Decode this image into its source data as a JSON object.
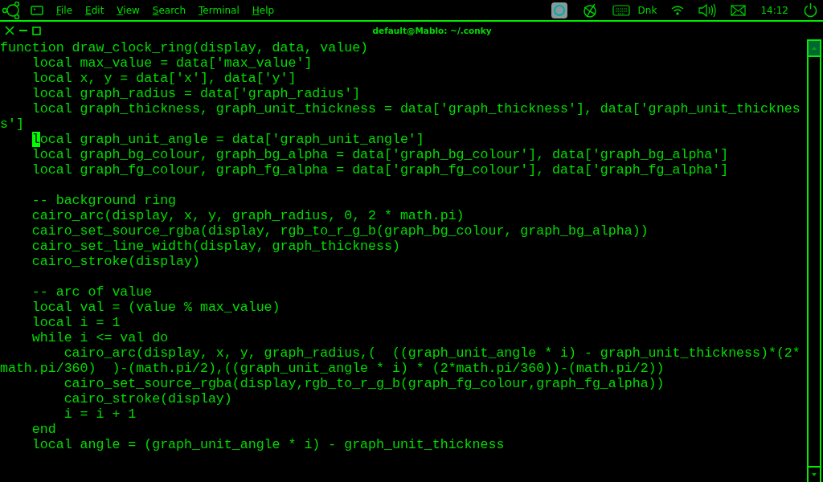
{
  "top_panel": {
    "menus": [
      {
        "label": "File"
      },
      {
        "label": "Edit"
      },
      {
        "label": "View"
      },
      {
        "label": "Search"
      },
      {
        "label": "Terminal"
      },
      {
        "label": "Help"
      }
    ],
    "keyboard_layout": "Dnk",
    "clock": "14:12"
  },
  "terminal": {
    "title": "default@Mablo: ~/.conky",
    "lines": [
      {
        "kind": "code",
        "text": "function draw_clock_ring(display, data, value)"
      },
      {
        "kind": "code",
        "text": "    local max_value = data['max_value']"
      },
      {
        "kind": "code",
        "text": "    local x, y = data['x'], data['y']"
      },
      {
        "kind": "code",
        "text": "    local graph_radius = data['graph_radius']"
      },
      {
        "kind": "code",
        "text": "    local graph_thickness, graph_unit_thickness = data['graph_thickness'], data['graph_unit_thicknes"
      },
      {
        "kind": "code",
        "text": "s']"
      },
      {
        "kind": "cursor",
        "indented": true,
        "cursor": "l",
        "after": "ocal graph_unit_angle = data['graph_unit_angle']"
      },
      {
        "kind": "code",
        "text": "    local graph_bg_colour, graph_bg_alpha = data['graph_bg_colour'], data['graph_bg_alpha']"
      },
      {
        "kind": "code",
        "text": "    local graph_fg_colour, graph_fg_alpha = data['graph_fg_colour'], data['graph_fg_alpha']"
      },
      {
        "kind": "blank"
      },
      {
        "kind": "code",
        "text": "    -- background ring"
      },
      {
        "kind": "code",
        "text": "    cairo_arc(display, x, y, graph_radius, 0, 2 * math.pi)"
      },
      {
        "kind": "code",
        "text": "    cairo_set_source_rgba(display, rgb_to_r_g_b(graph_bg_colour, graph_bg_alpha))"
      },
      {
        "kind": "code",
        "text": "    cairo_set_line_width(display, graph_thickness)"
      },
      {
        "kind": "code",
        "text": "    cairo_stroke(display)"
      },
      {
        "kind": "blank"
      },
      {
        "kind": "code",
        "text": "    -- arc of value"
      },
      {
        "kind": "code",
        "text": "    local val = (value % max_value)"
      },
      {
        "kind": "code",
        "text": "    local i = 1"
      },
      {
        "kind": "code",
        "text": "    while i <= val do"
      },
      {
        "kind": "code",
        "text": "        cairo_arc(display, x, y, graph_radius,(  ((graph_unit_angle * i) - graph_unit_thickness)*(2*"
      },
      {
        "kind": "code",
        "text": "math.pi/360)  )-(math.pi/2),((graph_unit_angle * i) * (2*math.pi/360))-(math.pi/2))"
      },
      {
        "kind": "code",
        "text": "        cairo_set_source_rgba(display,rgb_to_r_g_b(graph_fg_colour,graph_fg_alpha))"
      },
      {
        "kind": "code",
        "text": "        cairo_stroke(display)"
      },
      {
        "kind": "code",
        "text": "        i = i + 1"
      },
      {
        "kind": "code",
        "text": "    end"
      },
      {
        "kind": "code",
        "text": "    local angle = (graph_unit_angle * i) - graph_unit_thickness"
      }
    ]
  }
}
